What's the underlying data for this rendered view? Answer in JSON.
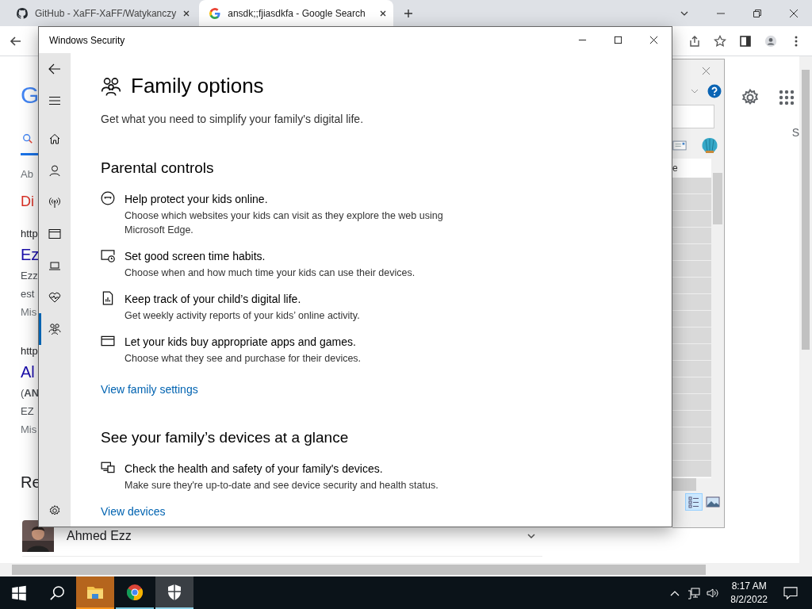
{
  "browser": {
    "tabs": [
      {
        "title": "GitHub - XaFF-XaFF/Watykanczy",
        "kind": "github",
        "selected": false
      },
      {
        "title": "ansdk;;fjiasdkfa - Google Search",
        "kind": "google",
        "selected": true
      }
    ],
    "page": {
      "logo": "G",
      "snippets": [
        {
          "text": "Ab",
          "kind": "muted"
        },
        {
          "text": "Di",
          "kind": "red"
        },
        {
          "text": "http",
          "kind": "url"
        },
        {
          "text": "Ez",
          "kind": "title"
        },
        {
          "text": "Ezz",
          "kind": "text"
        },
        {
          "text": "est",
          "kind": "text"
        },
        {
          "text": "Mis",
          "kind": "muted"
        },
        {
          "text": "http",
          "kind": "url"
        },
        {
          "text": "Al",
          "kind": "title"
        },
        {
          "text": "(**AN**",
          "kind": "text"
        },
        {
          "text": "EZ",
          "kind": "text"
        },
        {
          "text": "Mis",
          "kind": "muted"
        }
      ],
      "result_heading": "Re",
      "person": {
        "name": "Ahmed Ezz"
      },
      "side_text": "S"
    }
  },
  "back_dialog": {
    "column_1": "e"
  },
  "security": {
    "title": "Windows Security",
    "nav": [
      {
        "kind": "home",
        "selected": false
      },
      {
        "kind": "person",
        "selected": false
      },
      {
        "kind": "antenna",
        "selected": false
      },
      {
        "kind": "window",
        "selected": false
      },
      {
        "kind": "laptop",
        "selected": false
      },
      {
        "kind": "heart",
        "selected": false
      },
      {
        "kind": "family",
        "selected": true
      }
    ],
    "heading": "Family options",
    "subtitle": "Get what you need to simplify your family's digital life.",
    "sections": [
      {
        "title": "Parental controls",
        "items": [
          {
            "kind": "face",
            "title": "Help protect your kids online.",
            "description": "Choose which websites your kids can visit as they explore the web using Microsoft Edge."
          },
          {
            "kind": "clock",
            "title": "Set good screen time habits.",
            "description": "Choose when and how much time your kids can use their devices."
          },
          {
            "kind": "report",
            "title": "Keep track of your child’s digital life.",
            "description": "Get weekly activity reports of your kids’ online activity."
          },
          {
            "kind": "card",
            "title": "Let your kids buy appropriate apps and games.",
            "description": "Choose what they see and purchase for their devices."
          }
        ],
        "link": "View family settings"
      },
      {
        "title": "See your family’s devices at a glance",
        "items": [
          {
            "kind": "devices",
            "title": "Check the health and safety of your family's devices.",
            "description": "Make sure they're up-to-date and see device security and health status."
          }
        ],
        "link": "View devices"
      }
    ]
  },
  "taskbar": {
    "apps": [
      {
        "kind": "explorer",
        "active": false,
        "attention": true
      },
      {
        "kind": "chrome",
        "active": false,
        "attention": false
      },
      {
        "kind": "security",
        "active": true,
        "attention": false
      }
    ],
    "time": "8:17 AM",
    "date": "8/2/2022"
  }
}
